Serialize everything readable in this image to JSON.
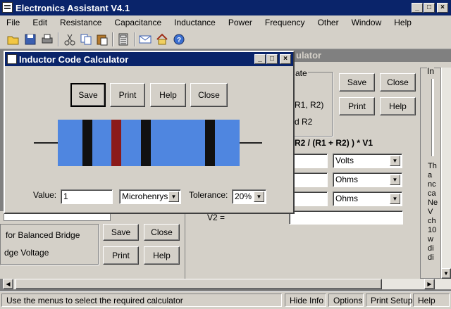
{
  "app": {
    "title": "Electronics Assistant V4.1",
    "caption_buttons": [
      "_",
      "□",
      "×"
    ]
  },
  "menu": [
    "File",
    "Edit",
    "Resistance",
    "Capacitance",
    "Inductance",
    "Power",
    "Frequency",
    "Other",
    "Window",
    "Help"
  ],
  "toolbar_icons": [
    "open-folder-icon",
    "save-disk-icon",
    "print-icon",
    "cut-icon",
    "copy-icon",
    "paste-icon",
    "calculator-icon",
    "email-icon",
    "home-icon",
    "help-icon"
  ],
  "background_window": {
    "title_fragment": "ulator",
    "group_fragment": "ate",
    "r_fragment": "R1, R2)",
    "r2_fragment": "d R2",
    "buttons": {
      "save": "Save",
      "close": "Close",
      "print": "Print",
      "help": "Help"
    },
    "formula": "R2  / (R1 + R2) ) * V1",
    "unit_rows": [
      "Volts",
      "Ohms",
      "Ohms"
    ],
    "v2_label": "V2 =",
    "side_letters": [
      "In",
      "Th",
      "a",
      "nc",
      "ca",
      "Ne",
      "V",
      "ch",
      "10",
      "w",
      "di",
      "di"
    ]
  },
  "lower_window": {
    "label_1": "for Balanced Bridge",
    "label_2": "dge Voltage",
    "buttons": {
      "save": "Save",
      "close": "Close",
      "print": "Print",
      "help": "Help"
    }
  },
  "dialog": {
    "title": "Inductor Code Calculator",
    "caption_buttons": [
      "_",
      "□",
      "×"
    ],
    "buttons": {
      "save": "Save",
      "print": "Print",
      "help": "Help",
      "close": "Close"
    },
    "bands": [
      {
        "color": "#111111"
      },
      {
        "color": "#8b1a1a"
      },
      {
        "color": "#111111"
      },
      {
        "color": "#111111"
      }
    ],
    "body_color": "#4f86e0",
    "value_label": "Value:",
    "value": "1",
    "unit": "Microhenrys",
    "tolerance_label": "Tolerance:",
    "tolerance": "20%"
  },
  "status": {
    "message": "Use the menus to select the required calculator",
    "items": [
      "Hide Info",
      "Options",
      "Print Setup",
      "Help"
    ]
  }
}
